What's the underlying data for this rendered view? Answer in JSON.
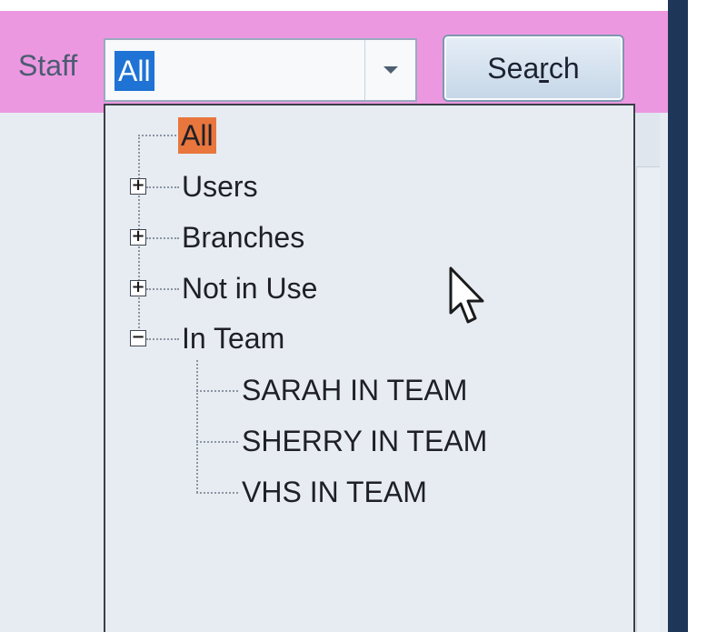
{
  "toolbar": {
    "staff_label": "Staff",
    "staff_value": "All",
    "search_label_before": "Sea",
    "search_label_mnemonic": "r",
    "search_label_after": "ch"
  },
  "tree": {
    "root": {
      "label": "All",
      "selected": true
    },
    "groups": [
      {
        "label": "Users",
        "expander": "+"
      },
      {
        "label": "Branches",
        "expander": "+"
      },
      {
        "label": "Not in Use",
        "expander": "+"
      },
      {
        "label": "In Team",
        "expander": "−"
      }
    ],
    "in_team_children": [
      "SARAH IN TEAM",
      "SHERRY IN TEAM",
      "VHS IN TEAM"
    ]
  },
  "icons": {
    "dropdown": "chevron-down-icon",
    "cursor": "mouse-pointer-icon"
  },
  "colors": {
    "toolbar_bg": "#ec98e1",
    "selection": "#1f73d4",
    "tree_selected": "#e8763d",
    "panel_bg": "#e7ecf2",
    "frame": "#1e3657"
  }
}
